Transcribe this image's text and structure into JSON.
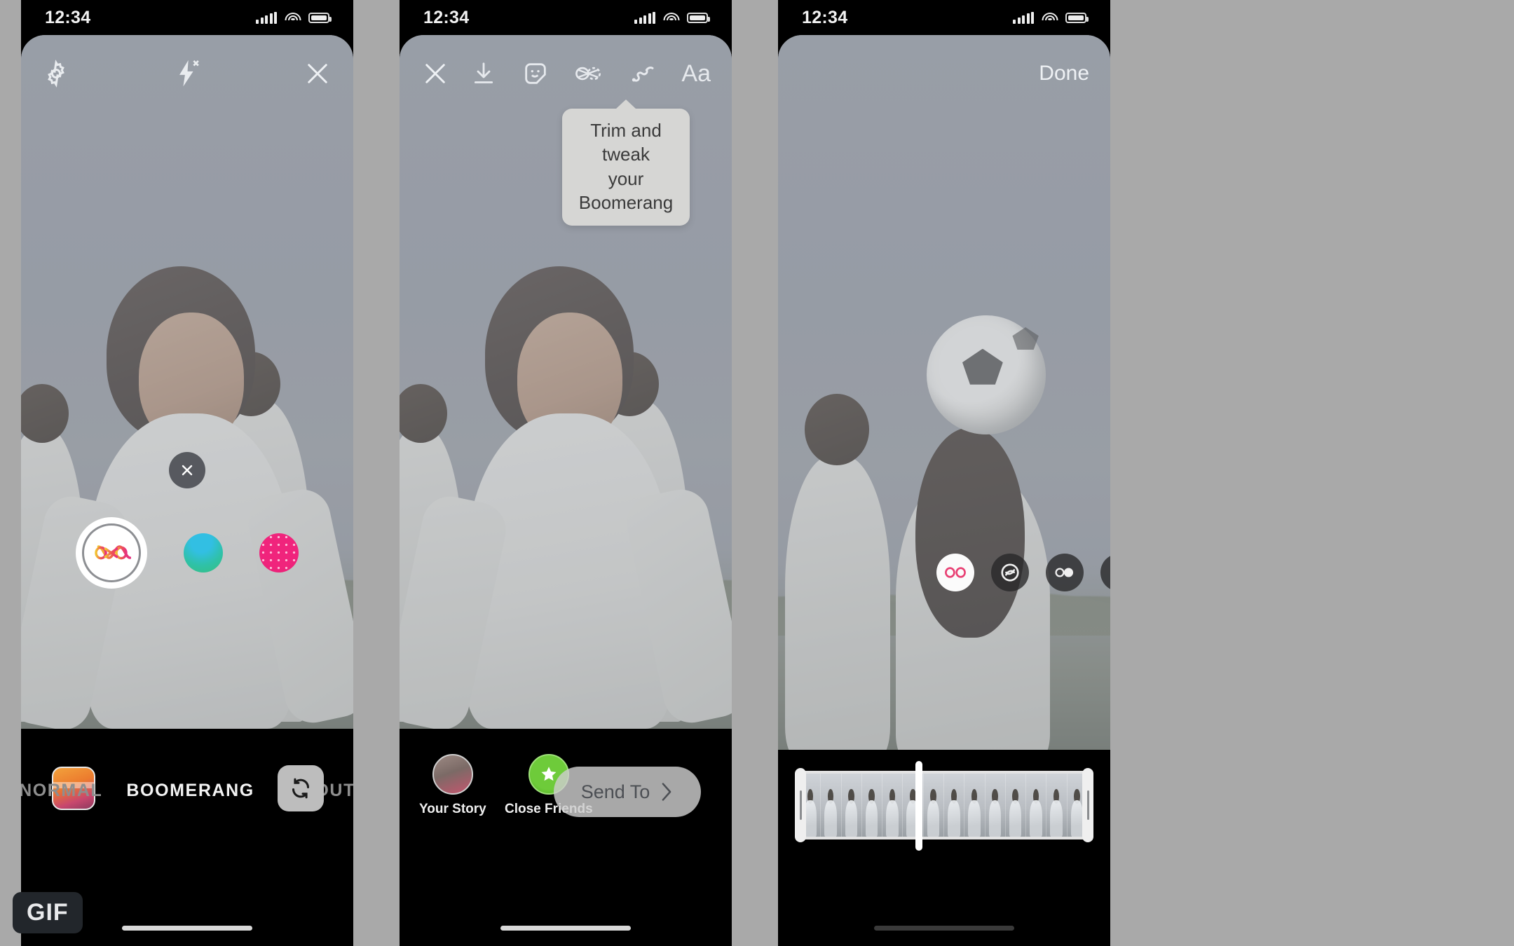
{
  "badge": {
    "label": "GIF"
  },
  "phones": [
    {
      "id": "camera",
      "status": {
        "time": "12:34",
        "signal_icon": "signal-bars-icon",
        "wifi_icon": "wifi-icon",
        "battery_icon": "battery-icon"
      },
      "top": {
        "settings_icon": "gear-icon",
        "flash_icon": "flash-off-icon",
        "close_icon": "close-icon"
      },
      "capture": {
        "dismiss_icon": "close-circle-icon",
        "shutter_icon": "boomerang-infinity-icon",
        "filters": [
          {
            "name": "filter-teal",
            "color": "#2fc1a8"
          },
          {
            "name": "filter-pink",
            "color": "#f0247c"
          }
        ]
      },
      "bottom": {
        "camera_roll_icon": "camera-roll-thumbnail",
        "flip_camera_icon": "flip-camera-icon",
        "modes": [
          {
            "label": "NORMAL",
            "active": false
          },
          {
            "label": "BOOMERANG",
            "active": true
          },
          {
            "label": "LAYOUT",
            "active": false
          }
        ]
      }
    },
    {
      "id": "editor",
      "status": {
        "time": "12:34",
        "signal_icon": "signal-bars-icon",
        "wifi_icon": "wifi-icon",
        "battery_icon": "battery-icon"
      },
      "top": {
        "close_icon": "close-icon",
        "tools": [
          {
            "name": "download-icon"
          },
          {
            "name": "sticker-icon"
          },
          {
            "name": "boomerang-icon"
          },
          {
            "name": "draw-icon"
          },
          {
            "name": "text-icon",
            "label": "Aa"
          }
        ]
      },
      "tooltip": {
        "line1": "Trim and tweak",
        "line2": "your Boomerang"
      },
      "bottom": {
        "destinations": [
          {
            "label": "Your Story",
            "avatar": "user-avatar"
          },
          {
            "label": "Close Friends",
            "avatar": "close-friends-star-icon"
          }
        ],
        "send": {
          "label": "Send To",
          "chevron_icon": "chevron-right-icon"
        }
      }
    },
    {
      "id": "boomerang-trim",
      "status": {
        "time": "12:34",
        "signal_icon": "signal-bars-icon",
        "wifi_icon": "wifi-icon",
        "battery_icon": "battery-icon"
      },
      "top": {
        "done_label": "Done"
      },
      "effects": [
        {
          "name": "effect-classic-icon",
          "active": true
        },
        {
          "name": "effect-echo-icon",
          "active": false
        },
        {
          "name": "effect-duo-icon",
          "active": false
        },
        {
          "name": "effect-slowmo-icon",
          "active": false
        }
      ],
      "trimmer": {
        "frames": 14,
        "left_handle": "trim-handle-left",
        "right_handle": "trim-handle-right",
        "playhead": "playhead"
      }
    }
  ]
}
